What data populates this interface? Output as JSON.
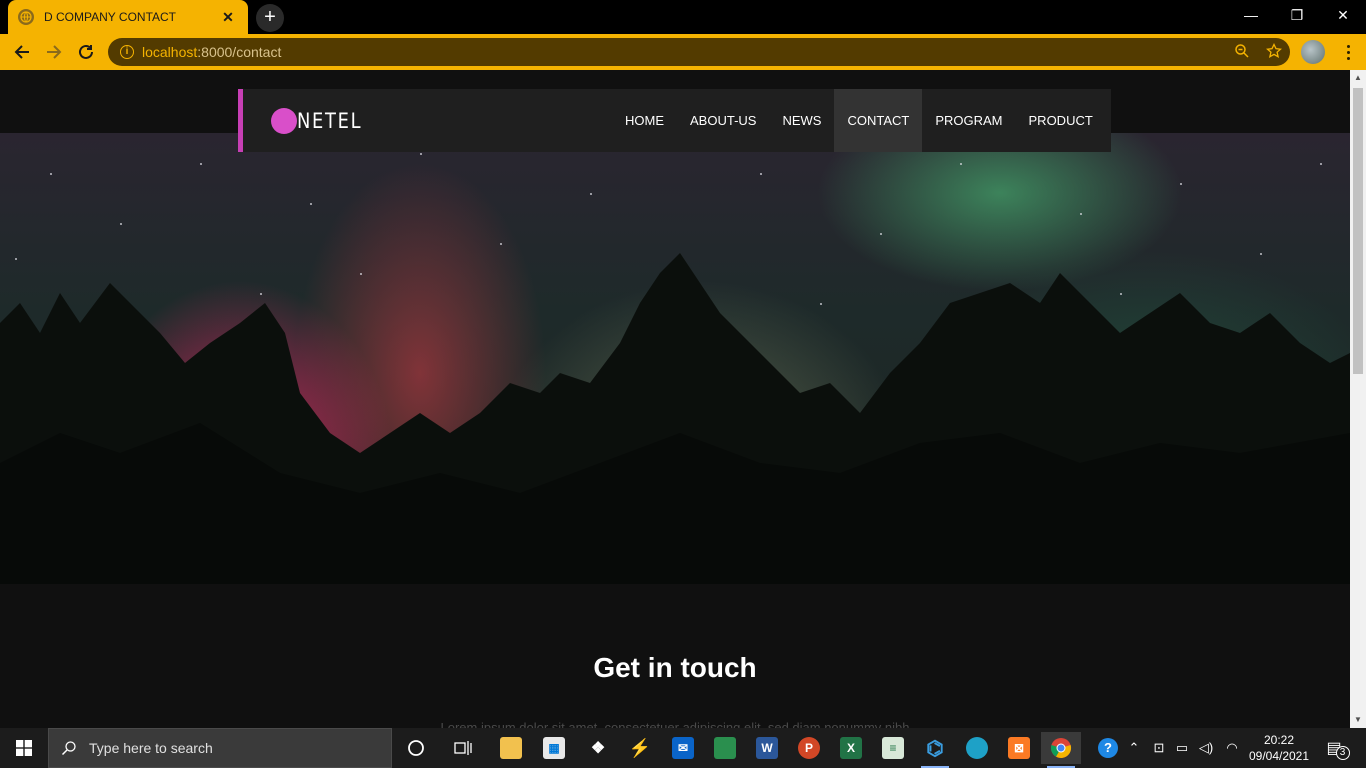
{
  "browser": {
    "tab_title": "D COMPANY CONTACT",
    "tab_close": "✕",
    "new_tab": "+",
    "url_host": "localhost",
    "url_path": ":8000/contact",
    "window_controls": {
      "minimize": "—",
      "restore": "❐",
      "close": "✕"
    }
  },
  "page": {
    "logo_text": "NETEL",
    "nav": [
      {
        "label": "HOME",
        "active": false
      },
      {
        "label": "ABOUT-US",
        "active": false
      },
      {
        "label": "NEWS",
        "active": false
      },
      {
        "label": "CONTACT",
        "active": true
      },
      {
        "label": "PROGRAM",
        "active": false
      },
      {
        "label": "PRODUCT",
        "active": false
      }
    ],
    "section_title": "Get in touch",
    "section_text": "Lorem ipsum dolor sit amet, consectetuer adipiscing elit, sed diam nonummy nibh"
  },
  "taskbar": {
    "search_placeholder": "Type here to search",
    "time": "20:22",
    "date": "09/04/2021",
    "notifications": "3",
    "apps": [
      "cortana-icon",
      "task-view-icon",
      "file-explorer-icon",
      "store-icon",
      "dropbox-icon",
      "arrow-app-icon",
      "mail-icon",
      "photos-icon",
      "word-icon",
      "powerpoint-icon",
      "excel-icon",
      "notepad-icon",
      "vscode-icon",
      "edge-icon",
      "xampp-icon",
      "chrome-icon"
    ]
  },
  "colors": {
    "accent": "#c73fb5",
    "chrome_yellow": "#f5b301",
    "navbar_bg": "#1f1f1f",
    "page_bg": "#101010"
  }
}
